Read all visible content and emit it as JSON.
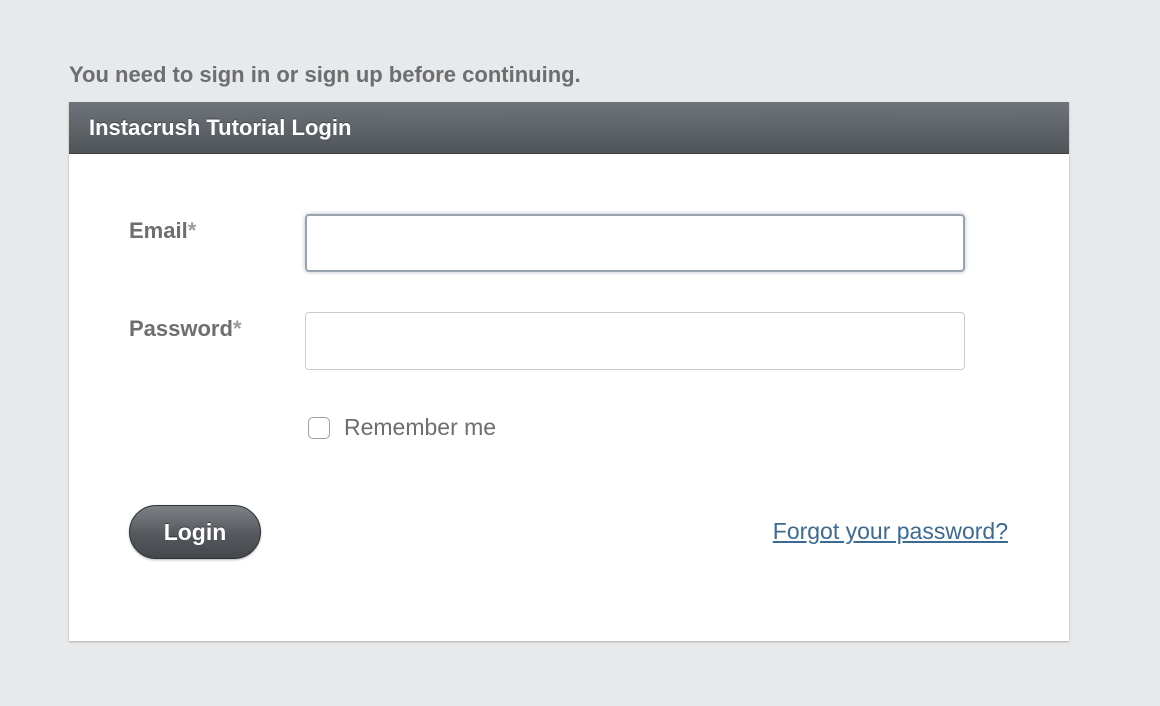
{
  "notice": "You need to sign in or sign up before continuing.",
  "panel": {
    "title": "Instacrush Tutorial Login"
  },
  "form": {
    "email": {
      "label": "Email",
      "required_marker": "*",
      "value": ""
    },
    "password": {
      "label": "Password",
      "required_marker": "*",
      "value": ""
    },
    "remember_me": {
      "label": "Remember me",
      "checked": false
    },
    "login_button": "Login",
    "forgot_link": "Forgot your password?"
  },
  "colors": {
    "background": "#e8e9ea",
    "header": "#5a5f64",
    "link": "#3b6a93",
    "label": "#6d6e70"
  }
}
